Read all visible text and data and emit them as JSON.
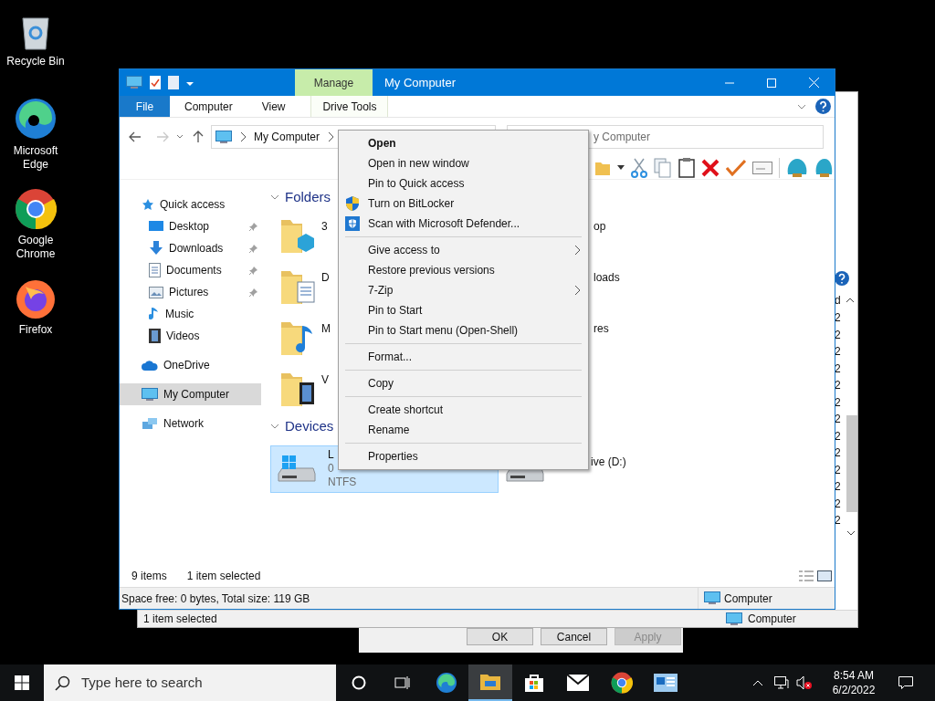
{
  "desktop_icons": [
    {
      "label": "Recycle Bin",
      "kind": "recycle"
    },
    {
      "label": "Microsoft Edge",
      "kind": "edge"
    },
    {
      "label": "Google Chrome",
      "kind": "chrome"
    },
    {
      "label": "Firefox",
      "kind": "firefox"
    }
  ],
  "dialog": {
    "buttons": [
      {
        "label": "OK",
        "disabled": false
      },
      {
        "label": "Cancel",
        "disabled": false
      },
      {
        "label": "Apply",
        "disabled": true
      }
    ]
  },
  "back_window": {
    "column_header": "d",
    "column_cells": [
      "2",
      "2",
      "2",
      "2",
      "2",
      "2",
      "2",
      "2",
      "2",
      "2",
      "2",
      "2",
      "2"
    ],
    "status": "1 item selected",
    "location": "Computer"
  },
  "window": {
    "title": "My Computer",
    "context_tab": "Manage",
    "ribbon_tabs": [
      {
        "label": "File",
        "kind": "file",
        "selected": false
      },
      {
        "label": "Computer",
        "kind": "tab",
        "selected": false
      },
      {
        "label": "View",
        "kind": "tab",
        "selected": false
      },
      {
        "label": "Drive Tools",
        "kind": "tab",
        "selected": false
      }
    ],
    "address": {
      "path": "My Computer"
    },
    "search": {
      "placeholder": "y Computer"
    },
    "sidebar": {
      "items": [
        {
          "label": "Quick access",
          "kind": "star",
          "selected": false,
          "children": [
            {
              "label": "Desktop",
              "kind": "desktop",
              "pinned": true,
              "selected": false
            },
            {
              "label": "Downloads",
              "kind": "downloads",
              "pinned": true,
              "selected": false
            },
            {
              "label": "Documents",
              "kind": "documents",
              "pinned": true,
              "selected": false
            },
            {
              "label": "Pictures",
              "kind": "pictures",
              "pinned": true,
              "selected": false
            },
            {
              "label": "Music",
              "kind": "music",
              "pinned": false,
              "selected": false
            },
            {
              "label": "Videos",
              "kind": "videos",
              "pinned": false,
              "selected": false
            }
          ]
        },
        {
          "label": "OneDrive",
          "kind": "cloud",
          "selected": false
        },
        {
          "label": "My Computer",
          "kind": "computer",
          "selected": true
        },
        {
          "label": "Network",
          "kind": "network",
          "selected": false
        }
      ]
    },
    "folders": {
      "title": "Folders",
      "items": [
        {
          "name": "3",
          "kind": "cube"
        },
        {
          "name": "op",
          "kind": "hidden"
        },
        {
          "name": "D",
          "kind": "documents"
        },
        {
          "name": "loads",
          "kind": "hidden"
        },
        {
          "name": "M",
          "kind": "music"
        },
        {
          "name": "res",
          "kind": "hidden"
        },
        {
          "name": "V",
          "kind": "videos"
        }
      ]
    },
    "devices": {
      "title": "Devices",
      "items": [
        {
          "lines": [
            "L",
            "0",
            "NTFS"
          ],
          "kind": "system",
          "selected": true
        },
        {
          "lines": [
            "ive (D:)"
          ],
          "kind": "drive",
          "selected": false
        }
      ]
    },
    "status": {
      "count": "9 items",
      "selection": "1 item selected"
    },
    "details_bar": {
      "info": "Space free: 0 bytes, Total size: 119 GB",
      "location": "Computer"
    }
  },
  "context_menu": {
    "items": [
      {
        "kind": "item",
        "label": "Open",
        "default": true,
        "submenu": false
      },
      {
        "kind": "item",
        "label": "Open in new window",
        "default": false,
        "submenu": false
      },
      {
        "kind": "item",
        "label": "Pin to Quick access",
        "default": false,
        "submenu": false
      },
      {
        "kind": "bitlocker",
        "label": "Turn on BitLocker",
        "default": false,
        "submenu": false
      },
      {
        "kind": "defender",
        "label": "Scan with Microsoft Defender...",
        "default": false,
        "submenu": false
      },
      {
        "kind": "separator"
      },
      {
        "kind": "item",
        "label": "Give access to",
        "default": false,
        "submenu": true
      },
      {
        "kind": "item",
        "label": "Restore previous versions",
        "default": false,
        "submenu": false
      },
      {
        "kind": "item",
        "label": "7-Zip",
        "default": false,
        "submenu": true
      },
      {
        "kind": "item",
        "label": "Pin to Start",
        "default": false,
        "submenu": false
      },
      {
        "kind": "item",
        "label": "Pin to Start menu (Open-Shell)",
        "default": false,
        "submenu": false
      },
      {
        "kind": "separator"
      },
      {
        "kind": "item",
        "label": "Format...",
        "default": false,
        "submenu": false
      },
      {
        "kind": "separator"
      },
      {
        "kind": "item",
        "label": "Copy",
        "default": false,
        "submenu": false
      },
      {
        "kind": "separator"
      },
      {
        "kind": "item",
        "label": "Create shortcut",
        "default": false,
        "submenu": false
      },
      {
        "kind": "item",
        "label": "Rename",
        "default": false,
        "submenu": false
      },
      {
        "kind": "separator"
      },
      {
        "kind": "item",
        "label": "Properties",
        "default": false,
        "submenu": false
      }
    ]
  },
  "taskbar": {
    "search": {
      "placeholder": "Type here to search"
    },
    "apps": [
      {
        "kind": "cortana",
        "selected": false
      },
      {
        "kind": "taskview",
        "selected": false
      },
      {
        "kind": "edge",
        "selected": false
      },
      {
        "kind": "explorer",
        "selected": true
      },
      {
        "kind": "store",
        "selected": false
      },
      {
        "kind": "mail",
        "selected": false
      },
      {
        "kind": "chrome",
        "selected": false
      },
      {
        "kind": "app",
        "selected": false
      }
    ],
    "time": "8:54 AM",
    "date": "6/2/2022"
  }
}
